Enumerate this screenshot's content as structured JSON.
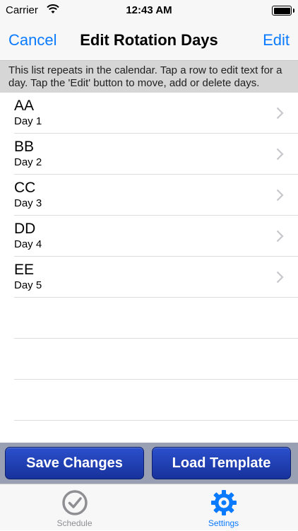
{
  "status_bar": {
    "carrier": "Carrier",
    "time": "12:43 AM"
  },
  "nav": {
    "left_label": "Cancel",
    "title": "Edit Rotation Days",
    "right_label": "Edit"
  },
  "info_text": "This list repeats in the calendar. Tap a row to edit text for a day. Tap the 'Edit' button to move, add or delete days.",
  "rotation_days": [
    {
      "title": "AA",
      "subtitle": "Day 1"
    },
    {
      "title": "BB",
      "subtitle": "Day 2"
    },
    {
      "title": "CC",
      "subtitle": "Day 3"
    },
    {
      "title": "DD",
      "subtitle": "Day 4"
    },
    {
      "title": "EE",
      "subtitle": "Day 5"
    }
  ],
  "buttons": {
    "save": "Save Changes",
    "load": "Load Template"
  },
  "tab_bar": {
    "tabs": [
      {
        "label": "Schedule",
        "icon": "clock-check-icon",
        "selected": false
      },
      {
        "label": "Settings",
        "icon": "gear-icon",
        "selected": true
      }
    ]
  },
  "colors": {
    "accent": "#0a7aff",
    "button": "#1f3db5",
    "button_bar": "#9aa0b4",
    "banner": "#d6d6d6",
    "tab_inactive": "#8e8e93"
  },
  "icons": {
    "wifi": "wifi-icon",
    "battery": "battery-icon",
    "chevron": "chevron-right-icon"
  }
}
